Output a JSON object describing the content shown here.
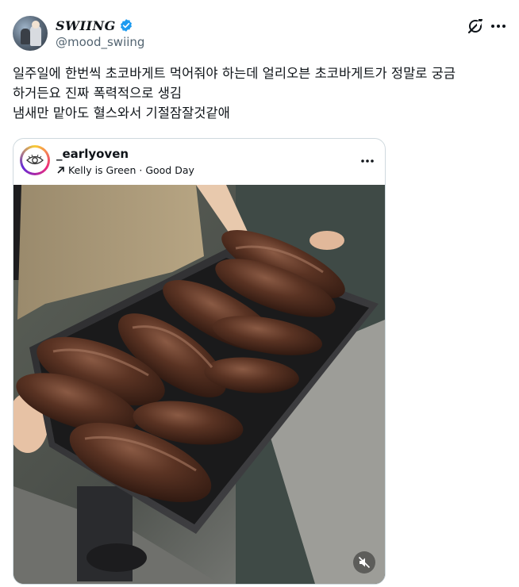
{
  "author": {
    "display_name": "SWIING",
    "handle": "@mood_swiing"
  },
  "icons": {
    "verified": "verified-badge-icon",
    "grok": "grok-icon",
    "more": "more-options-icon",
    "repost_arrow": "arrow-up-right-icon",
    "mute": "mute-icon"
  },
  "colors": {
    "verified_blue": "#1d9bf0",
    "handle_gray": "#536471"
  },
  "tweet": {
    "lines": [
      "일주일에 한번씩 초코바게트 먹어줘야 하는데 얼리오븐 초코바게트가 정말로 궁금",
      "하거든요 진짜 폭력적으로 생김",
      "냄새만 맡아도 혈스와서 기절잠잘것같애"
    ]
  },
  "embedded_post": {
    "username": "_earlyoven",
    "subtitle": "Kelly is Green · Good Day"
  }
}
